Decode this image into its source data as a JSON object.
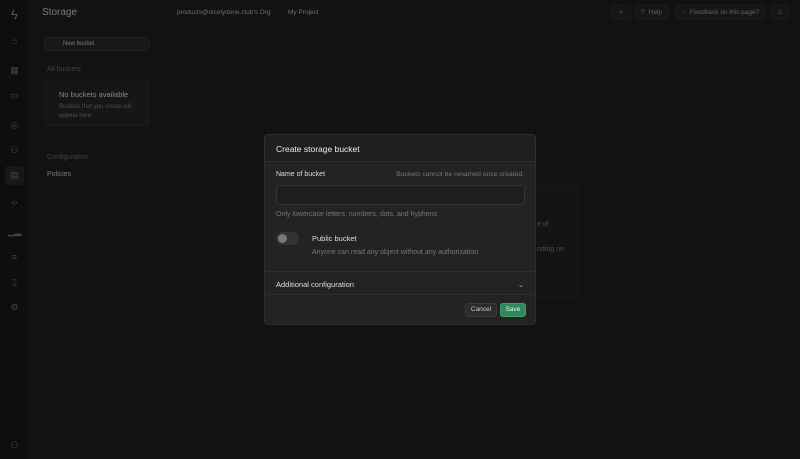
{
  "app": {
    "title": "Storage",
    "org": "products@nicelydone.club's Org",
    "project": "My Project"
  },
  "topbar": {
    "help": "Help",
    "feedback": "Feedback on this page?"
  },
  "menu": {
    "new_bucket": "New bucket",
    "all_buckets": "All buckets",
    "empty_title": "No buckets available",
    "empty_desc": "Buckets that you create will appear here",
    "configuration": "Configuration",
    "policies": "Policies"
  },
  "background": {
    "fragment1": "e of",
    "fragment2": "nding on"
  },
  "modal": {
    "title": "Create storage bucket",
    "name_label": "Name of bucket",
    "name_hint": "Buckets cannot be renamed once created.",
    "name_value": "",
    "name_help": "Only lowercase letters, numbers, dots, and hyphens",
    "public_label": "Public bucket",
    "public_desc": "Anyone can read any object without any authorization",
    "public_enabled": false,
    "additional": "Additional configuration",
    "cancel": "Cancel",
    "save": "Save"
  },
  "colors": {
    "accent": "#2f8a5b"
  }
}
